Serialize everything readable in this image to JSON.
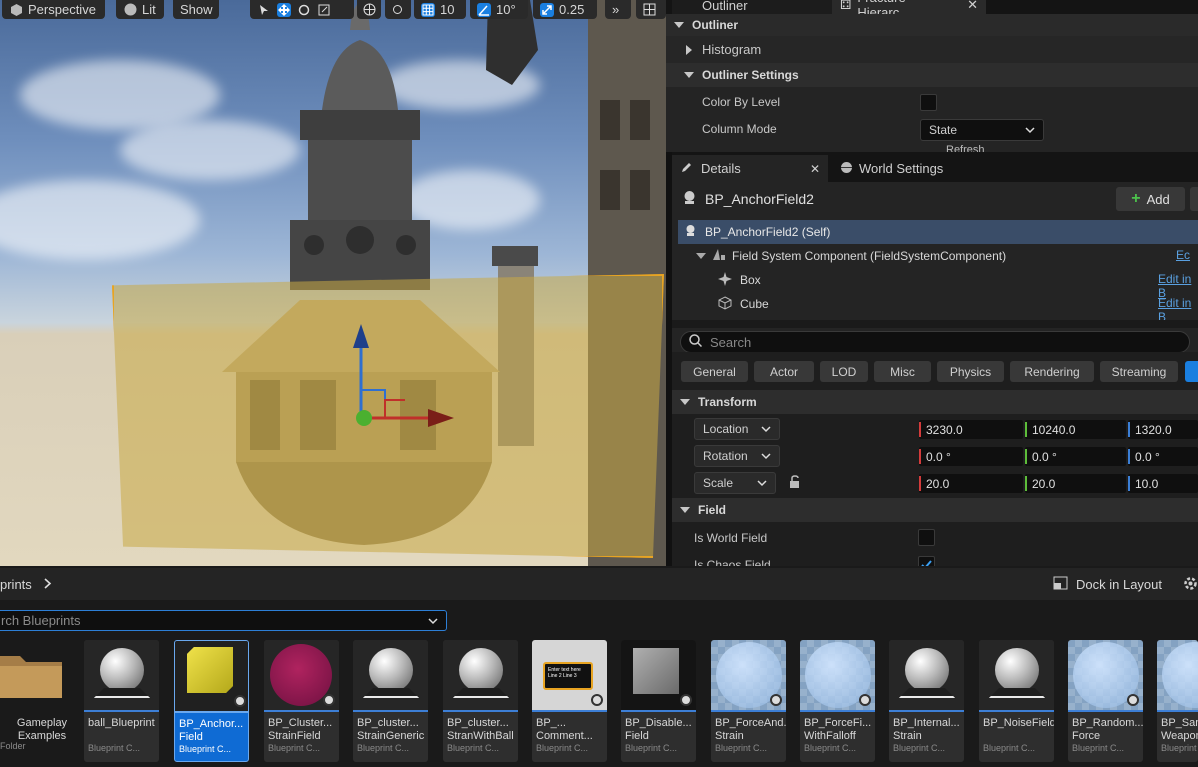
{
  "viewport": {
    "perspective": "Perspective",
    "lit": "Lit",
    "show": "Show",
    "grid_snap": "10",
    "angle_snap": "10°",
    "scale_snap": "0.25"
  },
  "outliner": {
    "tabs": [
      "Outliner",
      "Fracture Hierarc..."
    ],
    "header": "Outliner",
    "histogram": "Histogram",
    "settings_header": "Outliner Settings",
    "color_by_level": "Color By Level",
    "column_mode": "Column Mode",
    "column_mode_value": "State",
    "refresh": "Refresh"
  },
  "details": {
    "tab_details": "Details",
    "tab_world_settings": "World Settings",
    "actor_name": "BP_AnchorField2",
    "add_label": "Add",
    "tree": [
      {
        "label": "BP_AnchorField2 (Self)",
        "link": ""
      },
      {
        "label": "Field System Component (FieldSystemComponent)",
        "link": "Ec"
      },
      {
        "label": "Box",
        "link": "Edit in B"
      },
      {
        "label": "Cube",
        "link": "Edit in B"
      }
    ],
    "search_placeholder": "Search",
    "filters": [
      "General",
      "Actor",
      "LOD",
      "Misc",
      "Physics",
      "Rendering",
      "Streaming"
    ],
    "transform_header": "Transform",
    "location": {
      "label": "Location",
      "x": "3230.0",
      "y": "10240.0",
      "z": "1320.0"
    },
    "rotation": {
      "label": "Rotation",
      "x": "0.0 °",
      "y": "0.0 °",
      "z": "0.0 °"
    },
    "scale": {
      "label": "Scale",
      "x": "20.0",
      "y": "20.0",
      "z": "10.0"
    },
    "field_header": "Field",
    "is_world_field": "Is World Field",
    "is_chaos_field": "Is Chaos Field"
  },
  "content_browser": {
    "breadcrumb": "prints",
    "dock_label": "Dock in Layout",
    "search_placeholder": "rch Blueprints",
    "items": [
      {
        "name": "Gameplay Examples",
        "type": "Folder"
      },
      {
        "name": "ball_Blueprint",
        "type": "Blueprint C..."
      },
      {
        "name": "BP_Anchor... Field",
        "type": "Blueprint C..."
      },
      {
        "name": "BP_Cluster... StrainField",
        "type": "Blueprint C..."
      },
      {
        "name": "BP_cluster... StrainGeneric",
        "type": "Blueprint C..."
      },
      {
        "name": "BP_cluster... StranWithBall",
        "type": "Blueprint C..."
      },
      {
        "name": "BP_... Comment...",
        "type": "Blueprint C..."
      },
      {
        "name": "BP_Disable... Field",
        "type": "Blueprint C..."
      },
      {
        "name": "BP_ForceAnd... Strain",
        "type": "Blueprint C..."
      },
      {
        "name": "BP_ForceFi... WithFalloff",
        "type": "Blueprint C..."
      },
      {
        "name": "BP_Internal... Strain",
        "type": "Blueprint C..."
      },
      {
        "name": "BP_NoiseField",
        "type": "Blueprint C..."
      },
      {
        "name": "BP_Random... Force",
        "type": "Blueprint C..."
      },
      {
        "name": "BP_San... Weapon",
        "type": "Blueprint C..."
      }
    ],
    "comment_thumb_text": "Enter text here Line 2 Line 3"
  },
  "colors": {
    "accent": "#1a7fe0",
    "selection": "#e8a422",
    "x_axis": "#d33b3b",
    "y_axis": "#5dbd3a",
    "z_axis": "#3b7fd6"
  }
}
